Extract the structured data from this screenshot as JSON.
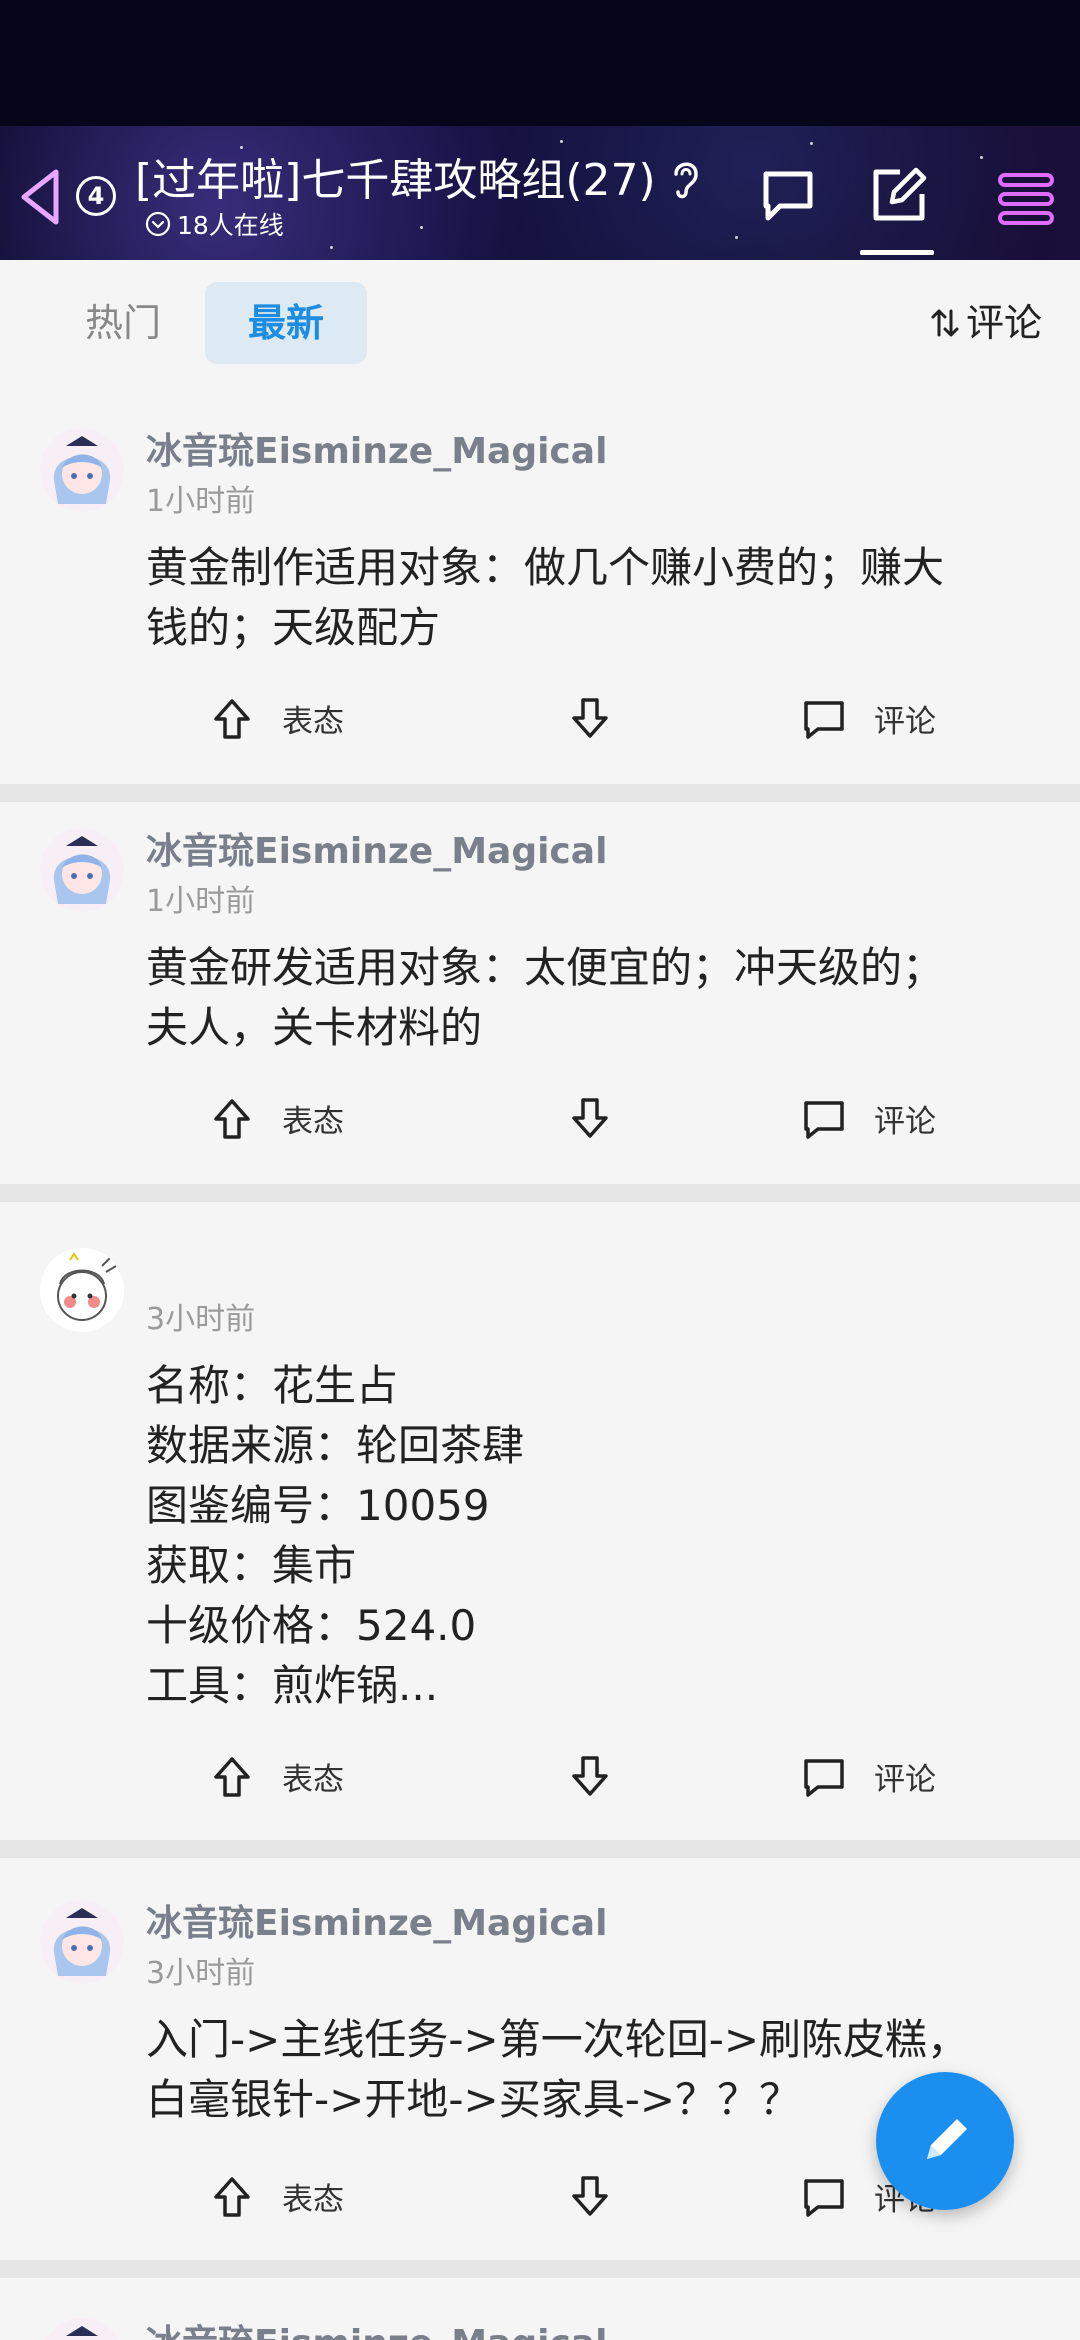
{
  "header": {
    "badge_count": "4",
    "title": "[过年啦]七千肆攻略组(27)",
    "online": "18人在线"
  },
  "tabs": {
    "hot": "热门",
    "new": "最新",
    "sort_label": "评论"
  },
  "actions": {
    "react": "表态",
    "comment": "评论"
  },
  "posts": [
    {
      "author": "冰音琉Eisminze_Magical",
      "time": "1小时前",
      "lines": [
        "黄金制作适用对象：做几个赚小费的；赚大",
        "钱的；天级配方"
      ]
    },
    {
      "author": "冰音琉Eisminze_Magical",
      "time": "1小时前",
      "lines": [
        "黄金研发适用对象：太便宜的；冲天级的；",
        "夫人，关卡材料的"
      ]
    },
    {
      "author": "",
      "time": "3小时前",
      "lines": [
        "名称：花生占",
        "数据来源：轮回茶肆",
        "图鉴编号：10059",
        "获取：集市",
        "十级价格：524.0",
        "工具：煎炸锅..."
      ]
    },
    {
      "author": "冰音琉Eisminze_Magical",
      "time": "3小时前",
      "lines": [
        "入门->主线任务->第一次轮回->刷陈皮糕，",
        "白毫银针->开地->买家具->？？？"
      ]
    },
    {
      "author": "冰音琉Eisminze_Magical",
      "time": "",
      "lines": []
    }
  ],
  "colors": {
    "accent": "#1c8de0",
    "fab": "#1a8ff0",
    "header_bg": "#0b0a2a",
    "author": "#7a7f8c"
  }
}
